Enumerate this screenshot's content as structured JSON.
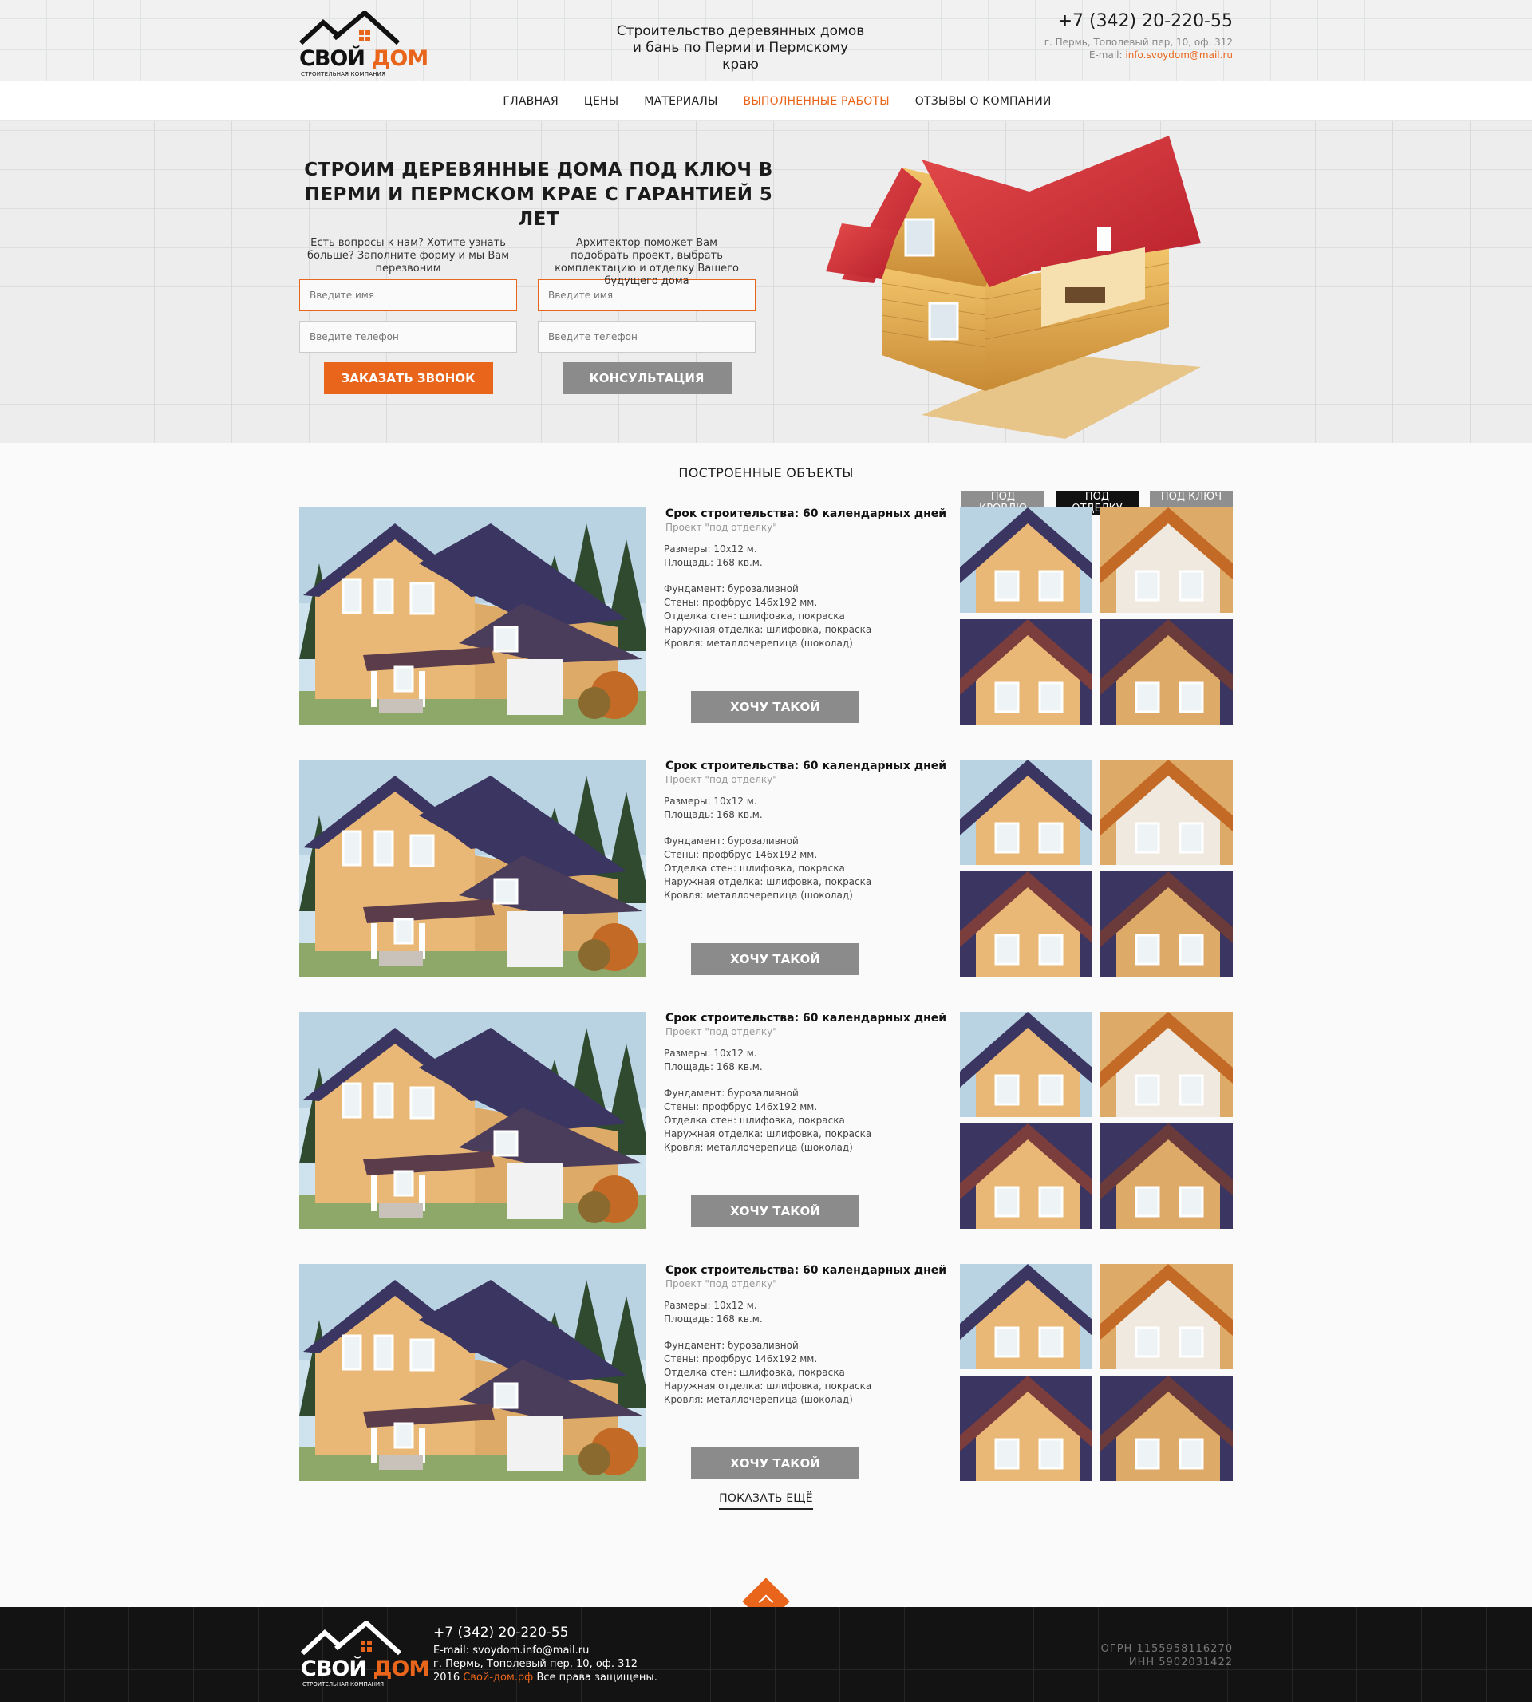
{
  "brand": {
    "name_part1": "СВОЙ",
    "name_part2": "ДОМ",
    "sub": "СТРОИТЕЛЬНАЯ КОМПАНИЯ"
  },
  "header": {
    "tagline_line1": "Строительство деревянных домов",
    "tagline_line2": "и бань по Перми и Пермскому краю",
    "phone": "+7 (342) 20-220-55",
    "address": "г. Пермь, Тополевый пер, 10, оф. 312",
    "email_label": "E-mail: ",
    "email": "info.svoydom@mail.ru"
  },
  "nav": {
    "items": [
      "ГЛАВНАЯ",
      "ЦЕНЫ",
      "МАТЕРИАЛЫ",
      "ВЫПОЛНЕННЫЕ РАБОТЫ",
      "ОТЗЫВЫ О КОМПАНИИ"
    ],
    "active": 3
  },
  "hero": {
    "title_line1": "СТРОИМ ДЕРЕВЯННЫЕ ДОМА ПОД КЛЮЧ В",
    "title_line2": "ПЕРМИ И ПЕРМСКОМ КРАЕ С ГАРАНТИЕЙ 5 ЛЕТ",
    "col1_text": "Есть вопросы к нам? Хотите узнать больше? Заполните форму и мы Вам перезвоним",
    "col2_text": "Архитектор поможет Вам подобрать проект, выбрать комплектацию и отделку Вашего будущего дома",
    "name_placeholder": "Введите имя",
    "phone_placeholder": "Введите телефон",
    "btn_call": "ЗАКАЗАТЬ ЗВОНОК",
    "btn_consult": "КОНСУЛЬТАЦИЯ"
  },
  "objects": {
    "title": "ПОСТРОЕННЫЕ ОБЪЕКТЫ",
    "filters": [
      "ПОД КРОВЛЮ",
      "ПОД ОТДЕЛКУ",
      "ПОД КЛЮЧ"
    ],
    "active_filter": 1,
    "items": [
      {
        "title": "Срок строительства: 60 календарных дней",
        "project": "Проект \"под отделку\"",
        "size": "Размеры: 10х12 м.",
        "area": "Площадь: 168 кв.м.",
        "foundation": "Фундамент: бурозаливной",
        "walls": "Стены: профбрус 146х192 мм.",
        "wall_finish": "Отделка стен: шлифовка, покраска",
        "outer_finish": "Наружная отделка: шлифовка, покраска",
        "roof": "Кровля: металлочерепица (шоколад)",
        "button": "ХОЧУ ТАКОЙ"
      },
      {
        "title": "Срок строительства: 60 календарных дней",
        "project": "Проект \"под отделку\"",
        "size": "Размеры: 10х12 м.",
        "area": "Площадь: 168 кв.м.",
        "foundation": "Фундамент: бурозаливной",
        "walls": "Стены: профбрус 146х192 мм.",
        "wall_finish": "Отделка стен: шлифовка, покраска",
        "outer_finish": "Наружная отделка: шлифовка, покраска",
        "roof": "Кровля: металлочерепица (шоколад)",
        "button": "ХОЧУ ТАКОЙ"
      },
      {
        "title": "Срок строительства: 60 календарных дней",
        "project": "Проект \"под отделку\"",
        "size": "Размеры: 10х12 м.",
        "area": "Площадь: 168 кв.м.",
        "foundation": "Фундамент: бурозаливной",
        "walls": "Стены: профбрус 146х192 мм.",
        "wall_finish": "Отделка стен: шлифовка, покраска",
        "outer_finish": "Наружная отделка: шлифовка, покраска",
        "roof": "Кровля: металлочерепица (шоколад)",
        "button": "ХОЧУ ТАКОЙ"
      },
      {
        "title": "Срок строительства: 60 календарных дней",
        "project": "Проект \"под отделку\"",
        "size": "Размеры: 10х12 м.",
        "area": "Площадь: 168 кв.м.",
        "foundation": "Фундамент: бурозаливной",
        "walls": "Стены: профбрус 146х192 мм.",
        "wall_finish": "Отделка стен: шлифовка, покраска",
        "outer_finish": "Наружная отделка: шлифовка, покраска",
        "roof": "Кровля: металлочерепица (шоколад)",
        "button": "ХОЧУ ТАКОЙ"
      }
    ],
    "show_more": "ПОКАЗАТЬ ЕЩЁ"
  },
  "footer": {
    "phone": "+7 (342) 20-220-55",
    "email_label": "E-mail: ",
    "email": "svoydom.info@mail.ru",
    "address": "г. Пермь, Тополевый пер, 10, оф. 312",
    "copy_year": "2016 ",
    "copy_site": "Свой-дом.рф",
    "copy_rest": " Все права защищены.",
    "ogrn": "ОГРН 1155958116270",
    "inn": "ИНН 5902031422"
  },
  "colors": {
    "accent": "#e8651b",
    "grey_button": "#8b8b8b",
    "dark": "#131313"
  },
  "icons": {
    "scroll_top": "chevron-up-icon",
    "logo": "house-roof-icon"
  }
}
